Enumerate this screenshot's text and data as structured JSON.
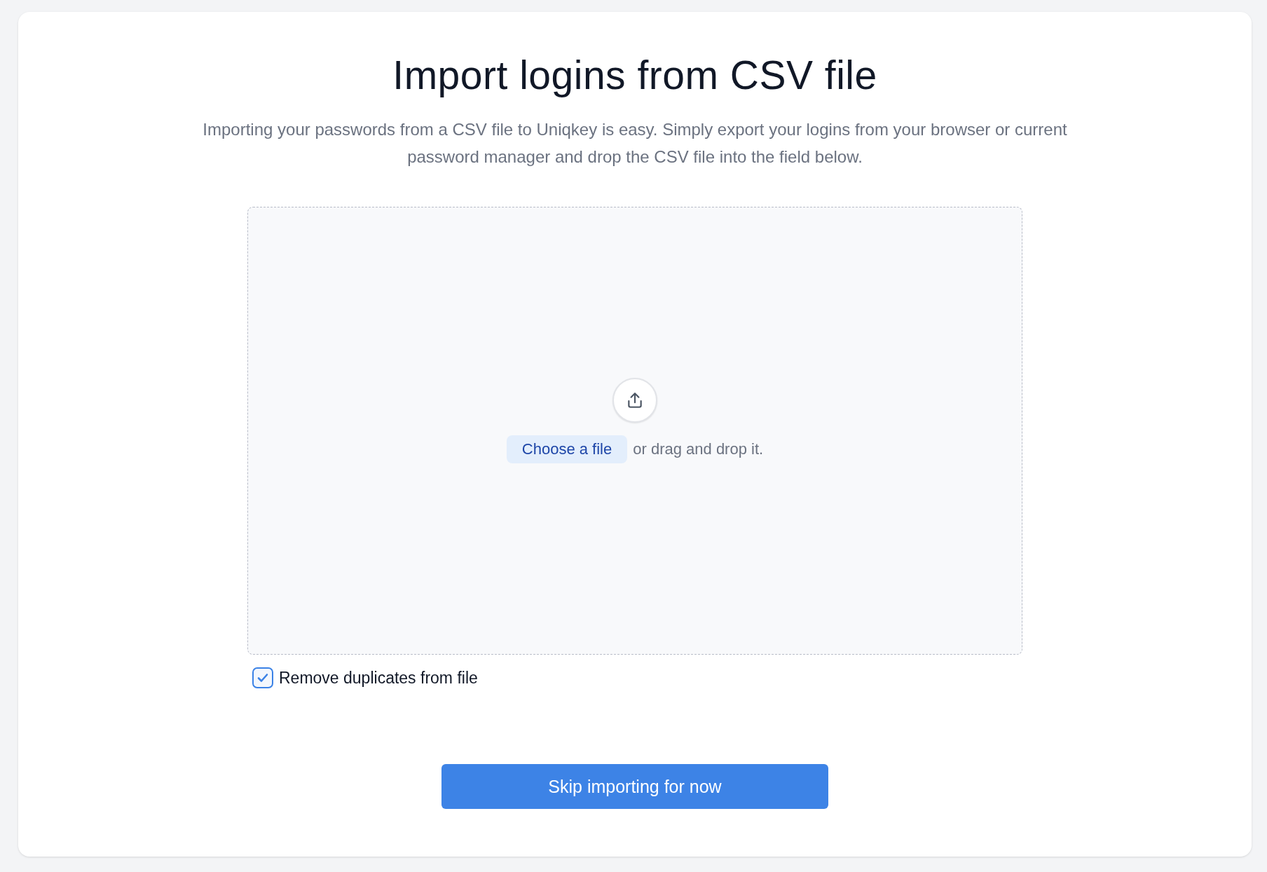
{
  "title": "Import logins from CSV file",
  "description": "Importing your passwords from a CSV file to Uniqkey is easy. Simply export your logins from your browser or current password manager and drop the CSV file into the field below.",
  "dropzone": {
    "choose_button": "Choose a file",
    "hint": "or drag and drop it."
  },
  "options": [
    {
      "label": "Remove duplicates from file",
      "checked": true
    }
  ],
  "buttons": [
    "Skip importing for now"
  ]
}
